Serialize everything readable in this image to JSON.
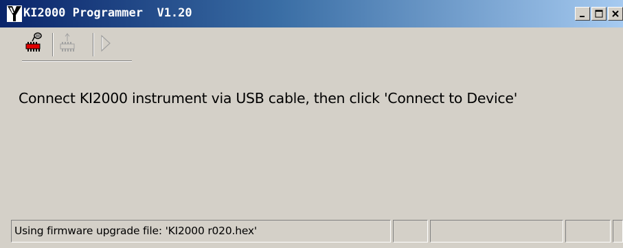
{
  "window": {
    "title": "KI2000 Programmer  V1.20",
    "icon": "ki2000-logo-icon",
    "controls": [
      {
        "name": "minimize-icon"
      },
      {
        "name": "maximize-icon"
      },
      {
        "name": "close-icon"
      }
    ]
  },
  "toolbar": {
    "items": [
      {
        "name": "connect-to-device",
        "icon": "chip-connect-icon",
        "enabled": true
      },
      {
        "name": "upload-firmware",
        "icon": "chip-upload-icon",
        "enabled": false
      },
      {
        "name": "run",
        "icon": "play-icon",
        "enabled": false
      }
    ]
  },
  "main": {
    "message": "Connect KI2000 instrument via USB cable, then click 'Connect to Device'"
  },
  "statusbar": {
    "text": "Using firmware upgrade file: 'KI2000 r020.hex'",
    "panels": [
      "",
      "",
      "",
      ""
    ]
  },
  "colors": {
    "titlebar_start": "#0a246a",
    "titlebar_end": "#a6caf0",
    "face": "#d4d0c8"
  }
}
